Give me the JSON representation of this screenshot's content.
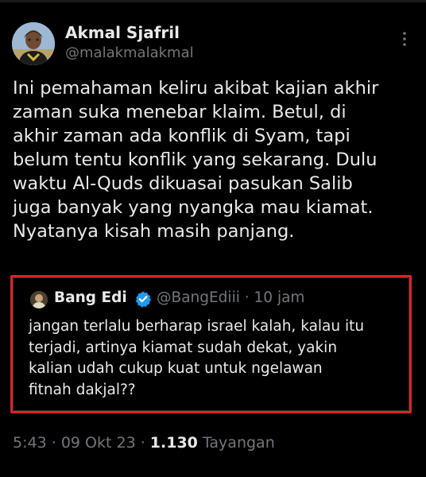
{
  "author": {
    "name": "Akmal Sjafril",
    "handle": "@malakmalakmal"
  },
  "tweet": {
    "lines": [
      "Ini pemahaman keliru akibat kajian akhir",
      "zaman suka menebar klaim. Betul, di",
      "akhir zaman ada konflik di Syam, tapi",
      "belum tentu konflik yang sekarang. Dulu",
      "waktu Al-Quds dikuasai pasukan Salib",
      "juga banyak yang nyangka mau kiamat.",
      "Nyatanya kisah masih panjang."
    ]
  },
  "quote": {
    "name": "Bang Edi",
    "handle": "@BangEdiii",
    "separator": "·",
    "time": "10 jam",
    "lines": [
      "jangan terlalu berharap israel kalah, kalau itu",
      "terjadi, artinya kiamat sudah dekat, yakin",
      "kalian udah cukup kuat untuk ngelawan",
      "fitnah dakjal??"
    ],
    "verified_icon": "verified-badge-icon",
    "highlight_color": "#e0212a"
  },
  "footer": {
    "time": "5:43",
    "separator": "·",
    "date": "09 Okt 23",
    "views_count": "1.130",
    "views_label": "Tayangan"
  },
  "colors": {
    "background": "#000000",
    "text_primary": "#e7e9ea",
    "text_secondary": "#71767b",
    "verified": "#1d9bf0"
  },
  "icons": {
    "more": "more-vertical-icon"
  }
}
